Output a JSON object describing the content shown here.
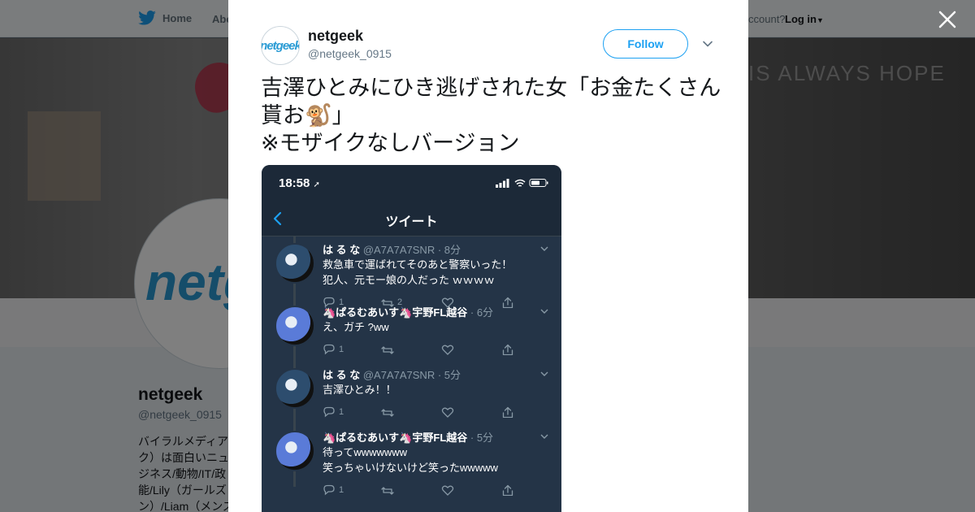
{
  "topnav": {
    "home_label": "Home",
    "about_label": "Abo",
    "account_prompt": "ccount?",
    "login_label": "Log in"
  },
  "banner": {
    "wall_text": "IS ALWAYS HOPE"
  },
  "profile": {
    "avatar_text": "netg",
    "name": "netgeek",
    "handle": "@netgeek_0915",
    "bio": "バイラルメディア\nク）は面白いニュ\nジネス/動物/IT/政\n能/Lily（ガールズ\nン）/Liam（メンズ"
  },
  "tweet": {
    "author_avatar_text": "netgeek",
    "author_name": "netgeek",
    "author_handle": "@netgeek_0915",
    "follow_label": "Follow",
    "text": "吉澤ひとみにひき逃げされた女「お金たくさん貰お🐒」\n※モザイクなしバージョン"
  },
  "screenshot": {
    "status_time": "18:58",
    "app_title": "ツイート",
    "replies": [
      {
        "name": "は る な",
        "handle": "@A7A7A7SNR · 8分",
        "text": "救急車で運ばれてそのあと警察いった！\n犯人、元モー娘の人だった ｗｗｗｗ",
        "reply_count": "1",
        "retweet_count": "2",
        "avatar_color": "#2d4d6e"
      },
      {
        "name": "🦄ぱるむあいす🦄宇野FL越谷",
        "handle": "· 6分",
        "text": "え、ガチ ?ww",
        "reply_count": "1",
        "retweet_count": "",
        "avatar_color": "#5a7bd8"
      },
      {
        "name": "は る な",
        "handle": "@A7A7A7SNR · 5分",
        "text": "吉澤ひとみ！！",
        "reply_count": "1",
        "retweet_count": "",
        "avatar_color": "#2d4d6e"
      },
      {
        "name": "🦄ぱるむあいす🦄宇野FL越谷",
        "handle": "· 5分",
        "text": "待ってwwwwwww\n笑っちゃいけないけど笑ったwwwww",
        "reply_count": "1",
        "retweet_count": "",
        "avatar_color": "#5a7bd8"
      }
    ]
  },
  "colors": {
    "twitter_blue": "#1da1f2",
    "dark_bg": "#243447",
    "dark_header": "#1c2938",
    "muted": "#8899a6"
  }
}
